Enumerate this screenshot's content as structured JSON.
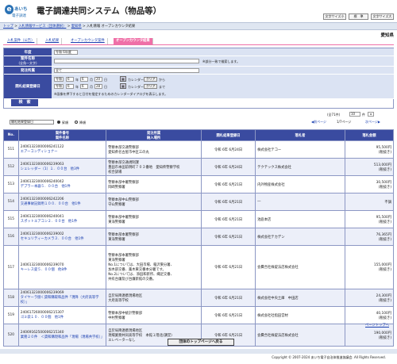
{
  "header": {
    "logo_top": "あいち",
    "logo_bottom": "電子調達",
    "title": "電子調達共同システム（物品等）",
    "buttons": [
      "文字サイズ小",
      "標　準",
      "文字サイズ大"
    ]
  },
  "breadcrumb": {
    "items": [
      "トップ",
      "入札情報サービス（団体選択）",
      "愛知県",
      "入札情報 オープンカウンタ結果"
    ],
    "sep": " > "
  },
  "prefecture": "愛知県",
  "tabs": [
    "入札案件（公告）",
    "入札結果",
    "オープンカウンタ案件",
    "オープンカウンタ結果"
  ],
  "form": {
    "year_label": "年度",
    "year_value": "令和 6年度",
    "case_label": "案件名称",
    "case_sub": "(全角一文字)",
    "case_hint": "※部分一致で検索します。",
    "section_label": "発注所属",
    "section_value": "全て",
    "date_label": "開札結果登録日",
    "date_row1": {
      "era": "令和",
      "y": "6",
      "y_u": "年",
      "m": "6",
      "m_u": "月",
      "d": "20",
      "d_u": "日",
      "cal": "カレンダー",
      "clear": "クリア",
      "suffix": "から"
    },
    "date_row2": {
      "era": "令和",
      "y": "6",
      "y_u": "年",
      "m": "6",
      "m_u": "月",
      "d": "28",
      "d_u": "日",
      "cal": "カレンダー",
      "clear": "クリア",
      "suffix": "まで"
    },
    "date_hint": "※画像を押下すると日付を指定するためのカレンダーダイアログを表示します。",
    "search": "検　索"
  },
  "controls": {
    "sort_value": "開札結果登録日",
    "asc": "昇順",
    "desc": "降順",
    "count": "(全71件)",
    "per_page": "10",
    "per_unit": "件",
    "prev": "前ページ",
    "page": "1/7ページ",
    "next": "次ページ"
  },
  "table": {
    "headers": {
      "no": "No.",
      "case_top": "案件番号",
      "case_bottom": "案件名称",
      "sec_top": "発注所属",
      "sec_bottom": "納入場所",
      "date": "開札結果登録日",
      "winner": "落札者",
      "amount": "落札金額"
    },
    "rows": [
      {
        "no": "511",
        "code": "24061323000006241122",
        "name": "エアーコンディショナー",
        "sec": "警察本部交通警察部",
        "place": "愛知県名古屋市中区三の丸",
        "date": "令和 6年 6月24日",
        "winner": "株式会社テコー",
        "amount": "95,500円",
        "tax": "(税抜き)"
      },
      {
        "no": "512",
        "code": "24061323000006239063",
        "name": "シェレッダー（1）１．００台　他3件",
        "sec": "警察本部交通規制課",
        "place": "豊田市本田前明町７０３番地　愛知県警察学校",
        "place2": "校合訓場",
        "date": "令和 6年 6月24日",
        "winner": "テクテックス株式会社",
        "amount": "513,000円",
        "tax": "(税抜き)"
      },
      {
        "no": "513",
        "code": "24061323000006240042",
        "name": "デプラー本器５．００台　他1件",
        "sec": "警察本部中署警察部",
        "place": "岡崎警察署",
        "date": "令和 6年 6月21日",
        "winner": "内外物産株式会社",
        "amount": "30,500円",
        "tax": "(税抜き)"
      },
      {
        "no": "514",
        "code": "24061323000006242206",
        "name": "交通事故記録用１００．００台　他1件",
        "sec": "警察本部中山警察部",
        "place": "守山警察署",
        "date": "令和 6年 6月21日",
        "winner": "―",
        "amount": "不調",
        "tax": ""
      },
      {
        "no": "515",
        "code": "24061323000006240041",
        "name": "スポットエアコン２．００台　他1件",
        "sec": "警察本部中署警察部",
        "place": "東海警察署",
        "date": "令和 6年 6月21日",
        "winner": "池庭本店",
        "amount": "95,500円",
        "tax": "(税抜き)"
      },
      {
        "no": "516",
        "code": "24061323000006239002",
        "name": "セキュリティーカメラ３．００台　他1件",
        "sec": "警察本部本署警察部",
        "place": "東海警察署",
        "date": "令和 6年 6月21日",
        "winner": "株式会社テカデン",
        "amount": "76,365円",
        "tax": "(税抜き)"
      },
      {
        "no": "517",
        "code": "24061323000006239070",
        "name": "キーレス錠５．００個　他8件",
        "sec": "警察本部本署警察部",
        "place": "東海警察署",
        "notes": [
          "No.1については、大田市場、稲沢東分署、",
          "加木部交番、薬木東交番本分署です。",
          "No.2については、添田和新所、縄足交番、",
          "共有台廉及び台廉新館の交番。"
        ],
        "date": "令和 6年 6月21日",
        "winner": "会費合社株錠法店株式会社",
        "amount": "155,000円",
        "tax": "(税抜き)"
      },
      {
        "no": "518",
        "code": "24061323000006239069",
        "name": "タイヤーラ捌く貸和購取和品件「現降（大府高等学校）」",
        "sec": "自於局降連携現場地区",
        "place": "大府高等学校",
        "date": "令和 6年 6月21日",
        "winner": "株式会社中央土庫　中田店",
        "amount": "24,300円",
        "tax": "(税抜き)"
      },
      {
        "no": "519",
        "code": "24061726000006215307",
        "name": "ゴミ袋１０．００個　他1件",
        "sec": "警察本部中統計警察部",
        "place": "中村警察署",
        "date": "令和 6年 6月21日",
        "winner": "株式会社社指田営材",
        "amount": "40,100円",
        "tax": "(税抜き)"
      },
      {
        "no": "520",
        "code": "24069162500006215340",
        "name": "業務２０件　＜貸和購現和品件「現場（現場共学校）」",
        "sec": "自於局降連携現場地区",
        "place": "現場業務共同高等学校　本館１階北(講堂）",
        "place2": "エレベーターなし",
        "date": "令和 6年 6月21日",
        "winner": "会費合社株錠法店株式会社",
        "amount": "190,000円",
        "tax": "(税抜き)"
      }
    ]
  },
  "footer": {
    "top_button": "団体のトップページへ戻る",
    "pagetop": "ページトップへ",
    "copyright": "Copyright © 2007-2024 あいち電子自治体推進協議会. All Rights Reserved."
  }
}
